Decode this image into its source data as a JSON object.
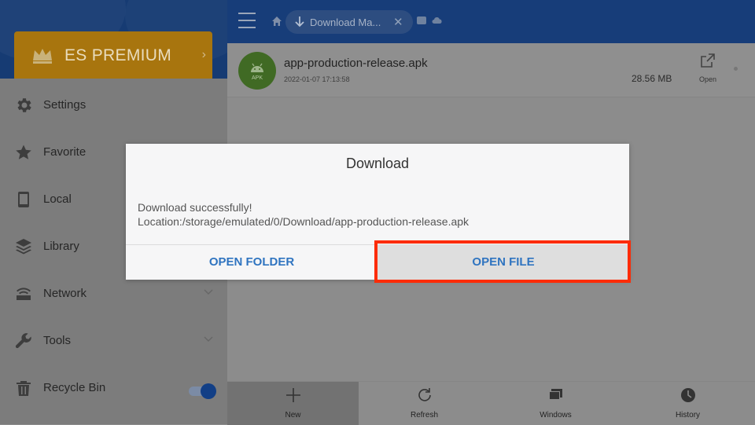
{
  "sidebar": {
    "premium_label": "ES PREMIUM",
    "items": [
      {
        "label": "Settings",
        "icon": "gear-icon"
      },
      {
        "label": "Favorite",
        "icon": "star-icon"
      },
      {
        "label": "Local",
        "icon": "phone-icon"
      },
      {
        "label": "Library",
        "icon": "layers-icon"
      },
      {
        "label": "Network",
        "icon": "router-icon"
      },
      {
        "label": "Tools",
        "icon": "wrench-icon"
      },
      {
        "label": "Recycle Bin",
        "icon": "trash-icon"
      }
    ],
    "recycle_bin_enabled": true
  },
  "topbar": {
    "breadcrumb": "Download Ma..."
  },
  "file": {
    "name": "app-production-release.apk",
    "date": "2022-01-07 17:13:58",
    "size": "28.56 MB",
    "open_label": "Open",
    "icon_text": "APK"
  },
  "bottom_bar": {
    "items": [
      {
        "label": "New",
        "icon": "plus-icon"
      },
      {
        "label": "Refresh",
        "icon": "refresh-icon"
      },
      {
        "label": "Windows",
        "icon": "windows-icon"
      },
      {
        "label": "History",
        "icon": "clock-icon"
      }
    ]
  },
  "dialog": {
    "title": "Download",
    "message_line1": "Download  successfully!",
    "message_line2": "Location:/storage/emulated/0/Download/app-production-release.apk",
    "open_folder_label": "OPEN FOLDER",
    "open_file_label": "OPEN FILE"
  },
  "colors": {
    "accent": "#2f74c0",
    "highlight": "#fc2b06",
    "topbar": "#173d79"
  }
}
